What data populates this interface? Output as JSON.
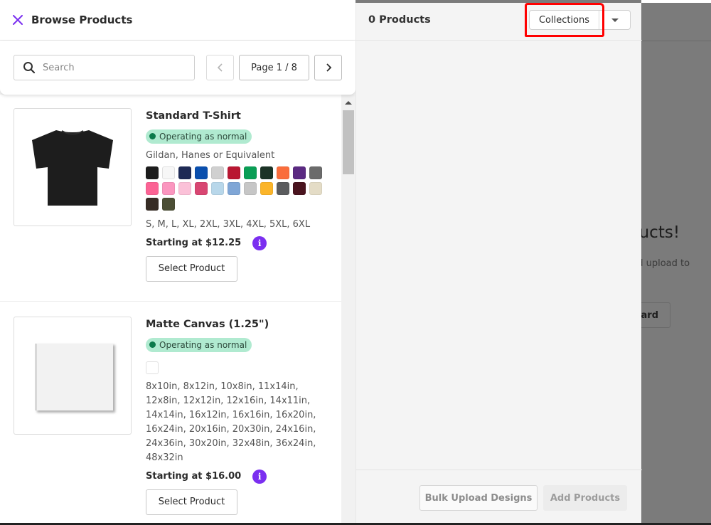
{
  "background_page": {
    "heading_fragment": "ducts!",
    "subtext_fragment": "nd upload to",
    "button_fragment": "oard"
  },
  "browse_panel": {
    "title": "Browse Products",
    "search": {
      "placeholder": "Search",
      "value": ""
    },
    "pagination": {
      "label": "Page 1 / 8",
      "current": 1,
      "total": 8
    },
    "products": [
      {
        "title": "Standard T-Shirt",
        "status": "Operating as normal",
        "brand": "Gildan, Hanes or Equivalent",
        "colors": [
          "#1c1c1c",
          "#f7f7f7",
          "#1e2a55",
          "#0a4fae",
          "#d0d0d0",
          "#b91732",
          "#0a9e55",
          "#1b3326",
          "#fa6d3c",
          "#5b2a82",
          "#6b6b6b",
          "#fb6394",
          "#fb96bf",
          "#fbc1d8",
          "#d84672",
          "#b8d7ea",
          "#7fa6d6",
          "#c6c6c6",
          "#fbb52a",
          "#5b5c5e",
          "#4a141f",
          "#e4dcc6",
          "#372c25",
          "#4c4f35"
        ],
        "sizes": "S, M, L, XL, 2XL, 3XL, 4XL, 5XL, 6XL",
        "price": "Starting at $12.25",
        "select_label": "Select Product"
      },
      {
        "title": "Matte Canvas (1.25\")",
        "status": "Operating as normal",
        "colors": [
          "#ffffff"
        ],
        "sizes": "8x10in, 8x12in, 10x8in, 11x14in, 12x8in, 12x12in, 12x16in, 14x11in, 14x14in, 16x12in, 16x16in, 16x20in, 16x24in, 20x16in, 20x30in, 24x16in, 24x36in, 30x20in, 32x48in, 36x24in, 48x32in",
        "price": "Starting at $16.00",
        "select_label": "Select Product"
      }
    ]
  },
  "selection_panel": {
    "count_label": "0 Products",
    "collections_label": "Collections",
    "bulk_upload_label": "Bulk Upload Designs",
    "add_products_label": "Add Products"
  },
  "colors": {
    "accent": "#7b2ff0",
    "status_bg": "#b0ead0",
    "status_dot": "#0c7a4b",
    "annotation": "#ff0000"
  }
}
